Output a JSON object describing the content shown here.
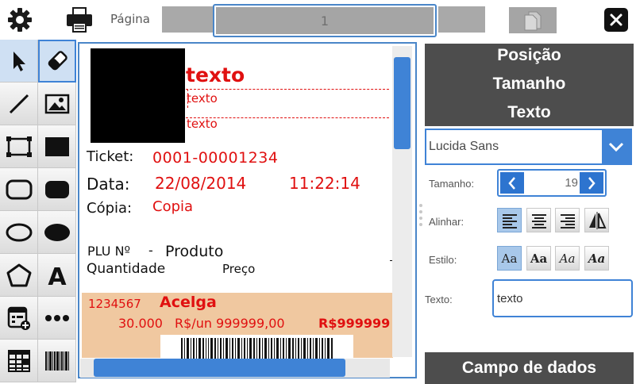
{
  "topbar": {
    "page_label": "Página",
    "page_value": "1",
    "settings_icon": "gear-icon",
    "print_icon": "printer-icon",
    "copy_icon": "copy-pages-icon",
    "close_icon": "close-icon"
  },
  "toolbar": {
    "tools": [
      "cursor-icon",
      "eraser-icon",
      "line-icon",
      "image-icon",
      "rectangle-outline-icon",
      "rectangle-filled-icon",
      "rounded-rect-outline-icon",
      "rounded-rect-filled-icon",
      "ellipse-outline-icon",
      "ellipse-filled-icon",
      "polygon-icon",
      "text-tool-icon",
      "add-field-icon",
      "more-icon",
      "table-icon",
      "barcode-icon"
    ]
  },
  "receipt": {
    "text_big": "texto",
    "text_small_1": "texto",
    "text_small_2": "texto",
    "ticket_label": "Ticket:",
    "ticket_value": "0001-00001234",
    "date_label": "Data:",
    "date_value": "22/08/2014",
    "time_value": "11:22:14",
    "copy_label": "Cópia:",
    "copy_value": "Copia",
    "plu_label": "PLU Nº",
    "plu_dash": "-",
    "product_label": "Produto",
    "qty_label": "Quantidade",
    "price_label": "Preço",
    "item_code": "1234567",
    "item_name": "Acelga",
    "item_qty": "30.000",
    "item_unit_price": "R$/un 999999,00",
    "item_total": "R$999999",
    "item_bg": "#f0c8a0"
  },
  "panel": {
    "tab_position": "Posição",
    "tab_size": "Tamanho",
    "tab_text": "Texto",
    "font_value": "Lucida Sans",
    "size_label": "Tamanho:",
    "size_value": "19",
    "align_label": "Alinhar:",
    "style_label": "Estilo:",
    "style_sample": "Aa",
    "text_label": "Texto:",
    "text_value": "texto",
    "data_field_label": "Campo de dados",
    "accent": "#3f83d6",
    "panel_bg": "#4d4d4d"
  }
}
